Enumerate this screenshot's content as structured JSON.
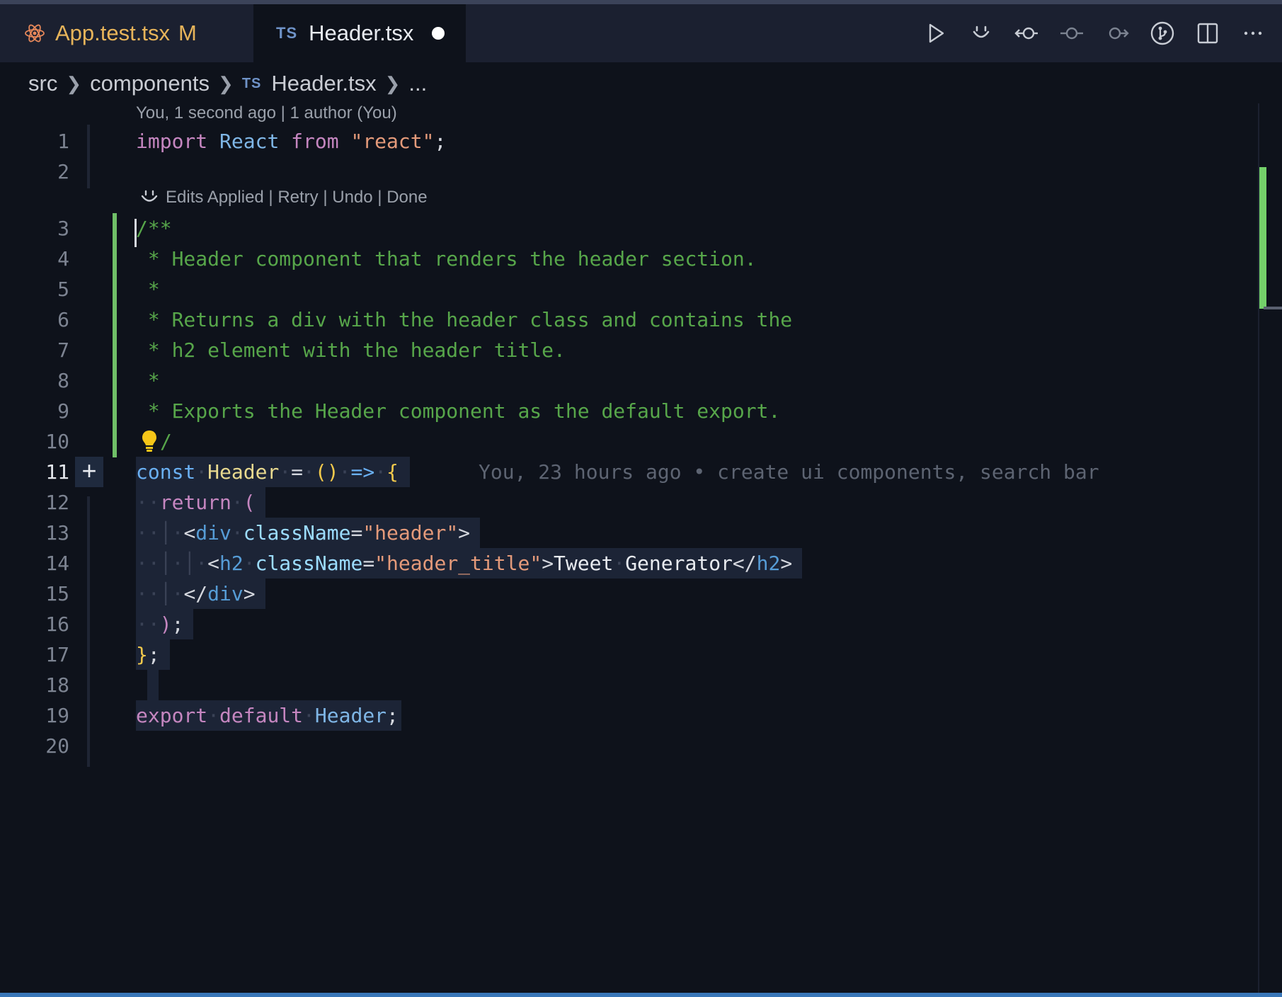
{
  "tabs": [
    {
      "name": "App.test.tsx",
      "status": "M",
      "icon": "react-icon"
    },
    {
      "name": "Header.tsx",
      "lang": "TS",
      "dirty": true
    }
  ],
  "breadcrumb": {
    "parts": [
      "src",
      "components",
      "Header.tsx",
      "..."
    ],
    "lang": "TS"
  },
  "blame_header": "You, 1 second ago | 1 author (You)",
  "codelens": {
    "text": "Edits Applied | Retry | Undo | Done"
  },
  "line_numbers": [
    "1",
    "2",
    "3",
    "4",
    "5",
    "6",
    "7",
    "8",
    "9",
    "10",
    "11",
    "12",
    "13",
    "14",
    "15",
    "16",
    "17",
    "18",
    "19",
    "20"
  ],
  "code": {
    "l1": {
      "kw": "import",
      "id": "React",
      "kw2": "from",
      "str": "\"react\"",
      "end": ";"
    },
    "l3": "/**",
    "l4": " * Header component that renders the header section.",
    "l5": " *",
    "l6": " * Returns a div with the header class and contains the",
    "l7": " * h2 element with the header title.",
    "l8": " *",
    "l9": " * Exports the Header component as the default export.",
    "l10": "/",
    "l11": {
      "kw": "const",
      "name": "Header",
      "eq": "=",
      "parens": "()",
      "arrow": "=>",
      "brace": "{"
    },
    "l12": {
      "kw": "return",
      "paren": "("
    },
    "l13": {
      "open": "<",
      "tag": "div",
      "attr": "className",
      "eq": "=",
      "val": "\"header\"",
      "close": ">"
    },
    "l14": {
      "open": "<",
      "tag": "h2",
      "attr": "className",
      "eq": "=",
      "val": "\"header_title\"",
      "close": ">",
      "text1": "Tweet",
      "text2": "Generator",
      "end_open": "</",
      "end_tag": "h2",
      "end_close": ">"
    },
    "l15": {
      "open": "</",
      "tag": "div",
      "close": ">"
    },
    "l16": {
      "paren": ")",
      "semi": ";"
    },
    "l17": {
      "brace": "}",
      "semi": ";"
    },
    "l19": {
      "kw1": "export",
      "kw2": "default",
      "id": "Header",
      "semi": ";"
    }
  },
  "ghost_blame": "You, 23 hours ago • create ui components, search bar",
  "colors": {
    "added": "#6fbf67",
    "accent": "#3a77b8",
    "modified_tab": "#e7b45a"
  }
}
